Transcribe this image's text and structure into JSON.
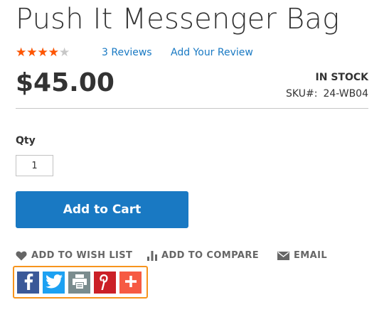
{
  "product": {
    "title": "Push It Messenger Bag",
    "rating": {
      "value": 3.5,
      "max": 5,
      "star_glyphs": "★★★★★"
    },
    "reviews_link": "3 Reviews",
    "add_review_link": "Add Your Review",
    "price": "$45.00",
    "stock_status": "IN STOCK",
    "sku_label": "SKU#:",
    "sku_value": "24-WB04"
  },
  "form": {
    "qty_label": "Qty",
    "qty_value": "1",
    "add_to_cart_label": "Add to Cart"
  },
  "actions": {
    "wishlist_label": "ADD TO WISH LIST",
    "compare_label": "ADD TO COMPARE",
    "email_label": "EMAIL"
  },
  "share_buttons": [
    {
      "name": "facebook",
      "icon": "facebook-icon",
      "color": "#3b5998"
    },
    {
      "name": "twitter",
      "icon": "twitter-icon",
      "color": "#1da1f2"
    },
    {
      "name": "print",
      "icon": "print-icon",
      "color": "#7a8c8e"
    },
    {
      "name": "pinterest",
      "icon": "pinterest-icon",
      "color": "#cb2027"
    },
    {
      "name": "more",
      "icon": "plus-icon",
      "color": "#f65a43"
    }
  ],
  "colors": {
    "link": "#1979c3",
    "primary_button": "#1979c3",
    "star_filled": "#ff5501",
    "star_empty": "#c7c7c7",
    "share_highlight_border": "#f7941d"
  }
}
